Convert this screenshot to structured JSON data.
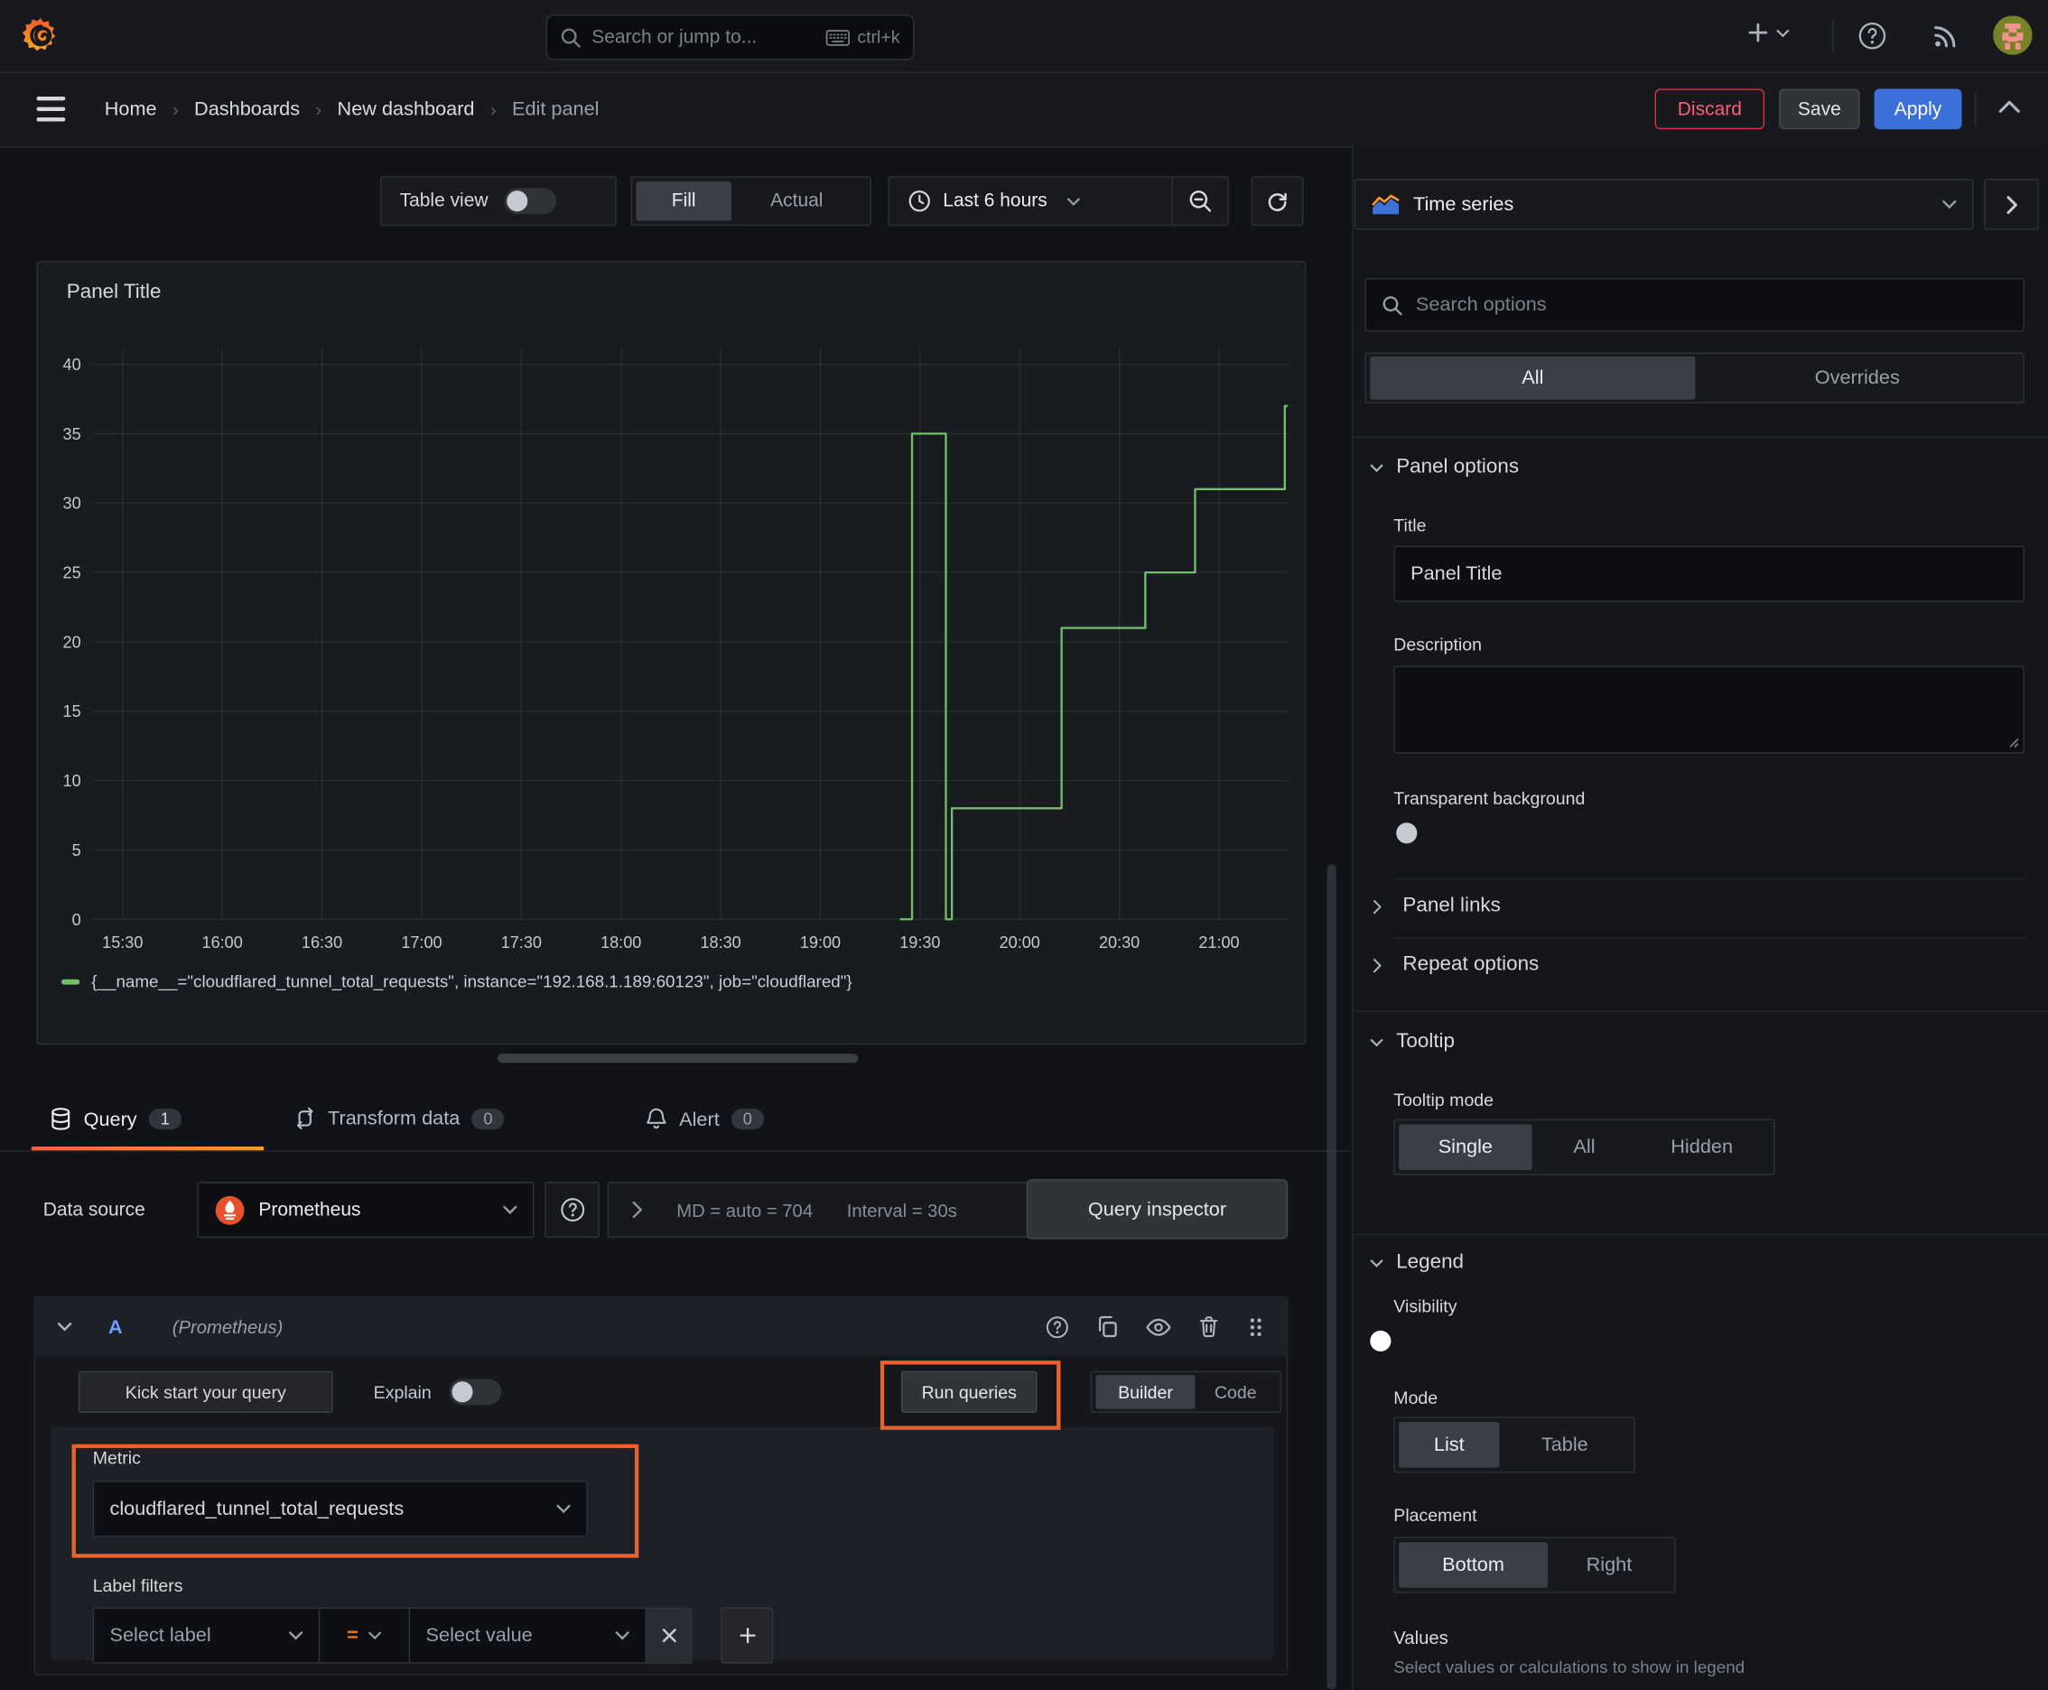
{
  "topbar": {
    "search_placeholder": "Search or jump to...",
    "shortcut": "ctrl+k"
  },
  "breadcrumb": {
    "items": [
      "Home",
      "Dashboards",
      "New dashboard",
      "Edit panel"
    ]
  },
  "actions": {
    "discard": "Discard",
    "save": "Save",
    "apply": "Apply"
  },
  "toolbar": {
    "table_view": "Table view",
    "fill": "Fill",
    "actual": "Actual",
    "time_range": "Last 6 hours"
  },
  "viz_picker": {
    "label": "Time series"
  },
  "options_search": {
    "placeholder": "Search options"
  },
  "options_tabs": {
    "all": "All",
    "overrides": "Overrides"
  },
  "panel_options": {
    "heading": "Panel options",
    "title_label": "Title",
    "title_value": "Panel Title",
    "description_label": "Description",
    "transparent_label": "Transparent background"
  },
  "collapsed_sections": {
    "panel_links": "Panel links",
    "repeat_options": "Repeat options"
  },
  "tooltip_section": {
    "heading": "Tooltip",
    "mode_label": "Tooltip mode",
    "modes": [
      "Single",
      "All",
      "Hidden"
    ],
    "selected": "Single"
  },
  "legend_section": {
    "heading": "Legend",
    "visibility_label": "Visibility",
    "mode_label": "Mode",
    "modes": [
      "List",
      "Table"
    ],
    "selected_mode": "List",
    "placement_label": "Placement",
    "placements": [
      "Bottom",
      "Right"
    ],
    "selected_placement": "Bottom",
    "values_label": "Values",
    "values_help": "Select values or calculations to show in legend"
  },
  "panel": {
    "title": "Panel Title"
  },
  "query_tabs": {
    "query": "Query",
    "query_count": "1",
    "transform": "Transform data",
    "transform_count": "0",
    "alert": "Alert",
    "alert_count": "0"
  },
  "datasource_row": {
    "label": "Data source",
    "name": "Prometheus",
    "stats": "MD = auto = 704",
    "interval": "Interval = 30s",
    "inspector": "Query inspector"
  },
  "query_a": {
    "letter": "A",
    "ds_hint": "(Prometheus)"
  },
  "query_editor": {
    "kickstart": "Kick start your query",
    "explain": "Explain",
    "run": "Run queries",
    "builder": "Builder",
    "code": "Code",
    "metric_label": "Metric",
    "metric_value": "cloudflared_tunnel_total_requests",
    "label_filters": "Label filters",
    "select_label": "Select label",
    "equals": "=",
    "select_value": "Select value"
  },
  "icons": [
    "grafana-logo",
    "search",
    "keyboard",
    "plus",
    "caret-down",
    "help-circle",
    "rss",
    "avatar",
    "hamburger",
    "chevron-up",
    "clock",
    "zoom-out",
    "refresh",
    "timeseries-viz",
    "chevron-right",
    "database",
    "transform-arrows",
    "bell",
    "copy",
    "eye",
    "trash",
    "grip-dots",
    "close-x",
    "prometheus-logo",
    "resize-handle"
  ],
  "chart_data": {
    "type": "line",
    "title": "Panel Title",
    "series": [
      {
        "name": "{__name__=\"cloudflared_tunnel_total_requests\", instance=\"192.168.1.189:60123\", job=\"cloudflared\"}",
        "color": "#73bf69",
        "points": [
          [
            19.4,
            0
          ],
          [
            19.46,
            0
          ],
          [
            19.46,
            35
          ],
          [
            19.63,
            35
          ],
          [
            19.63,
            0
          ],
          [
            19.66,
            0
          ],
          [
            19.66,
            8
          ],
          [
            20.21,
            8
          ],
          [
            20.21,
            21
          ],
          [
            20.63,
            21
          ],
          [
            20.63,
            25
          ],
          [
            20.88,
            25
          ],
          [
            20.88,
            31
          ],
          [
            21.33,
            31
          ],
          [
            21.33,
            37
          ],
          [
            21.345,
            37
          ]
        ]
      }
    ],
    "x_ticks": [
      {
        "label": "15:30",
        "value": 15.5
      },
      {
        "label": "16:00",
        "value": 16.0
      },
      {
        "label": "16:30",
        "value": 16.5
      },
      {
        "label": "17:00",
        "value": 17.0
      },
      {
        "label": "17:30",
        "value": 17.5
      },
      {
        "label": "18:00",
        "value": 18.0
      },
      {
        "label": "18:30",
        "value": 18.5
      },
      {
        "label": "19:00",
        "value": 19.0
      },
      {
        "label": "19:30",
        "value": 19.5
      },
      {
        "label": "20:00",
        "value": 20.0
      },
      {
        "label": "20:30",
        "value": 20.5
      },
      {
        "label": "21:00",
        "value": 21.0
      }
    ],
    "y_ticks": [
      0,
      5,
      10,
      15,
      20,
      25,
      30,
      35,
      40
    ],
    "xlim": [
      15.35,
      21.345
    ],
    "ylim": [
      0,
      40
    ],
    "grid": true,
    "legend_position": "bottom"
  }
}
